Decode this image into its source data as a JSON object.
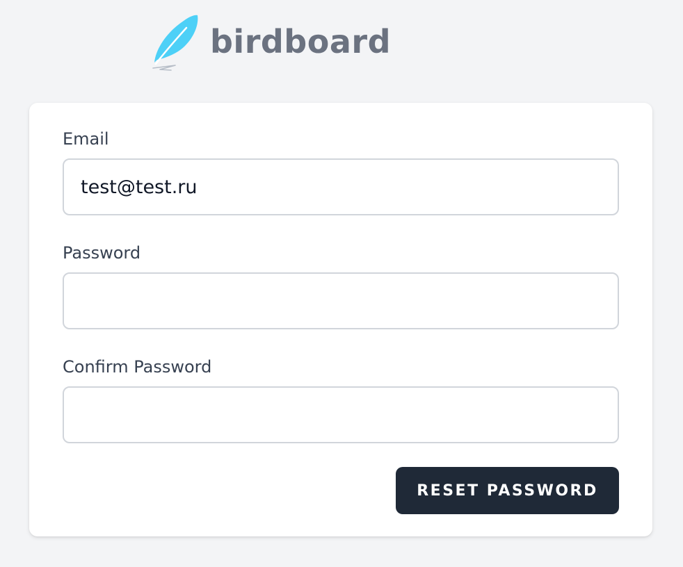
{
  "brand": {
    "name": "birdboard",
    "icon": "feather-icon",
    "icon_color": "#4dd0f7",
    "text_color": "#6b7280"
  },
  "form": {
    "email": {
      "label": "Email",
      "value": "test@test.ru"
    },
    "password": {
      "label": "Password",
      "value": ""
    },
    "confirm_password": {
      "label": "Confirm Password",
      "value": ""
    },
    "submit_label": "RESET PASSWORD"
  },
  "colors": {
    "background": "#f3f4f6",
    "card": "#ffffff",
    "button": "#1f2937",
    "input_border": "#d1d5db"
  }
}
